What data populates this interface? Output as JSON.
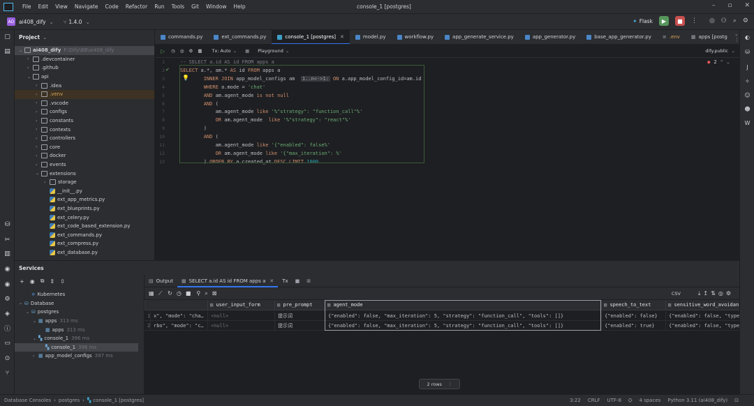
{
  "title_bar": {
    "menu": [
      "File",
      "Edit",
      "View",
      "Navigate",
      "Code",
      "Refactor",
      "Run",
      "Tools",
      "Git",
      "Window",
      "Help"
    ],
    "window_title": "console_1 [postgres]"
  },
  "toolbar": {
    "project_badge": "AD",
    "project_name": "ai408_dify",
    "branch": "1.4.0",
    "run_config": "Flask"
  },
  "project_panel": {
    "title": "Project",
    "root": "ai408_dify",
    "root_path": "F:\\Dify\\BB\\ai408_dify",
    "items": [
      {
        "label": ".devcontainer",
        "depth": 1,
        "type": "folder"
      },
      {
        "label": ".github",
        "depth": 1,
        "type": "folder"
      },
      {
        "label": "api",
        "depth": 1,
        "type": "folder-open"
      },
      {
        "label": ".idea",
        "depth": 2,
        "type": "folder"
      },
      {
        "label": ".venv",
        "depth": 2,
        "type": "folder"
      },
      {
        "label": ".vscode",
        "depth": 2,
        "type": "folder"
      },
      {
        "label": "configs",
        "depth": 2,
        "type": "folder"
      },
      {
        "label": "constants",
        "depth": 2,
        "type": "folder"
      },
      {
        "label": "contexts",
        "depth": 2,
        "type": "folder"
      },
      {
        "label": "controllers",
        "depth": 2,
        "type": "folder"
      },
      {
        "label": "core",
        "depth": 2,
        "type": "folder"
      },
      {
        "label": "docker",
        "depth": 2,
        "type": "folder"
      },
      {
        "label": "events",
        "depth": 2,
        "type": "folder"
      },
      {
        "label": "extensions",
        "depth": 2,
        "type": "folder-open"
      },
      {
        "label": "storage",
        "depth": 3,
        "type": "folder"
      },
      {
        "label": "__init__.py",
        "depth": 3,
        "type": "py"
      },
      {
        "label": "ext_app_metrics.py",
        "depth": 3,
        "type": "py"
      },
      {
        "label": "ext_blueprints.py",
        "depth": 3,
        "type": "py"
      },
      {
        "label": "ext_celery.py",
        "depth": 3,
        "type": "py"
      },
      {
        "label": "ext_code_based_extension.py",
        "depth": 3,
        "type": "py"
      },
      {
        "label": "ext_commands.py",
        "depth": 3,
        "type": "py"
      },
      {
        "label": "ext_compress.py",
        "depth": 3,
        "type": "py"
      },
      {
        "label": "ext_database.py",
        "depth": 3,
        "type": "py"
      }
    ]
  },
  "editor_tabs": [
    "commands.py",
    "ext_commands.py",
    "console_1 [postgres]",
    "model.py",
    "workflow.py",
    "app_generate_service.py",
    "app_generator.py",
    "base_app_generator.py",
    ".env",
    "apps [postg"
  ],
  "console_toolbar": {
    "tx": "Tx: Auto",
    "playground": "Playground",
    "schema": "dify.public"
  },
  "editor": {
    "problems": "2",
    "lines": [
      {
        "n": "1",
        "text": "-- SELECT a.id AS id FROM apps a"
      },
      {
        "n": "2",
        "text": "SELECT a.*, am.* AS id FROM apps a"
      },
      {
        "n": "3",
        "text": "        INNER JOIN app_model_configs am  1..n<->1: ON a.app_model_config_id=am.id"
      },
      {
        "n": "4",
        "text": "        WHERE a.mode = 'chat'"
      },
      {
        "n": "5",
        "text": "        AND am.agent_mode is not null"
      },
      {
        "n": "6",
        "text": "        AND ("
      },
      {
        "n": "7",
        "text": "            am.agent_mode like '%\"strategy\": \"function_call\"%'"
      },
      {
        "n": "8",
        "text": "            OR am.agent_mode  like '%\"strategy\": \"react\"%'"
      },
      {
        "n": "9",
        "text": "        )"
      },
      {
        "n": "10",
        "text": "        AND ("
      },
      {
        "n": "11",
        "text": "            am.agent_mode like '{\"enabled\": false%'"
      },
      {
        "n": "12",
        "text": "            OR am.agent_mode like '{\"max_iteration\": %'"
      },
      {
        "n": "13",
        "text": "        ) ORDER BY a.created_at DESC LIMIT 1000"
      }
    ]
  },
  "services": {
    "title": "Services",
    "items": [
      {
        "label": "Kubernetes",
        "hint": "",
        "depth": 1
      },
      {
        "label": "Database",
        "hint": "",
        "depth": 0
      },
      {
        "label": "postgres",
        "hint": "",
        "depth": 1
      },
      {
        "label": "apps",
        "hint": "313 ms",
        "depth": 2
      },
      {
        "label": "apps",
        "hint": "313 ms",
        "depth": 3
      },
      {
        "label": "console_1",
        "hint": "396 ms",
        "depth": 2
      },
      {
        "label": "console_1",
        "hint": "396 ms",
        "depth": 3
      },
      {
        "label": "app_model_configs",
        "hint": "397 ms",
        "depth": 2
      }
    ]
  },
  "results": {
    "tabs": [
      "Output",
      "SELECT a.id AS id FROM apps a",
      "Tx"
    ],
    "format": "CSV",
    "columns": [
      "",
      "user_input_form",
      "pre_prompt",
      "agent_mode",
      "speech_to_text",
      "sensitive_word_avoidan"
    ],
    "rows": [
      {
        "n": "1",
        "c0": "x\", \"mode\": \"cha…",
        "c1": "<null>",
        "c2": "提示词",
        "c3": "{\"enabled\": false, \"max_iteration\": 5, \"strategy\": \"function_call\", \"tools\": []}",
        "c4": "{\"enabled\": false}",
        "c5": "{\"enabled\": false, \"type"
      },
      {
        "n": "2",
        "c0": "rbo\", \"mode\": \"c…",
        "c1": "<null>",
        "c2": "提示词",
        "c3": "{\"enabled\": false, \"max_iteration\": 5, \"strategy\": \"function_call\", \"tools\": []}",
        "c4": "{\"enabled\": true}",
        "c5": "{\"enabled\": false, \"type"
      }
    ],
    "rows_label": "2 rows"
  },
  "status_bar": {
    "breadcrumb": [
      "Database Consoles",
      "postgres",
      "console_1 [postgres]"
    ],
    "position": "3:22",
    "line_sep": "CRLF",
    "encoding": "UTF-8",
    "indent": "4 spaces",
    "interpreter": "Python 3.11 (ai408_dify)"
  }
}
